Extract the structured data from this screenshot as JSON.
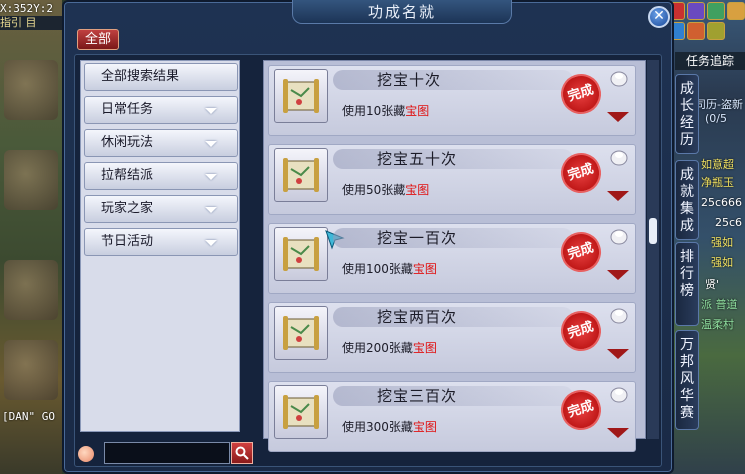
{
  "hud": {
    "coords": "X:352Y:2",
    "toolstrip": "指引  目",
    "chat": "[DAN\" GO"
  },
  "tracker": {
    "label": "任务追踪",
    "fragments": [
      "司历-盗新",
      "(0/5",
      "如意超",
      "净瓶玉",
      "25c666",
      "25c6",
      "强如",
      "强如",
      "贤'",
      "派 普道",
      "温柔村"
    ]
  },
  "window": {
    "title": "功成名就",
    "close_glyph": "✕",
    "filter_tab": "全部"
  },
  "sidebar": {
    "items": [
      {
        "label": "全部搜索结果",
        "has_arrow": false
      },
      {
        "label": "日常任务",
        "has_arrow": true
      },
      {
        "label": "休闲玩法",
        "has_arrow": true
      },
      {
        "label": "拉帮结派",
        "has_arrow": true
      },
      {
        "label": "玩家之家",
        "has_arrow": true
      },
      {
        "label": "节日活动",
        "has_arrow": true
      }
    ]
  },
  "search": {
    "value": "",
    "icon_left": "peach-icon",
    "icon_button": "search-icon"
  },
  "achievements": [
    {
      "name": "挖宝十次",
      "desc_prefix": "使用10张藏",
      "desc_highlight": "宝图",
      "seal": "完成"
    },
    {
      "name": "挖宝五十次",
      "desc_prefix": "使用50张藏",
      "desc_highlight": "宝图",
      "seal": "完成"
    },
    {
      "name": "挖宝一百次",
      "desc_prefix": "使用100张藏",
      "desc_highlight": "宝图",
      "seal": "完成"
    },
    {
      "name": "挖宝两百次",
      "desc_prefix": "使用200张藏",
      "desc_highlight": "宝图",
      "seal": "完成"
    },
    {
      "name": "挖宝三百次",
      "desc_prefix": "使用300张藏",
      "desc_highlight": "宝图",
      "seal": "完成"
    }
  ],
  "side_tabs": [
    {
      "label": "成长经历"
    },
    {
      "label": "成就集成"
    },
    {
      "label": "排行榜"
    },
    {
      "label": "万邦风华赛"
    }
  ],
  "colors": {
    "accent_red": "#c01818",
    "highlight_text": "#e01010",
    "panel_bg": "#1a2a46"
  }
}
